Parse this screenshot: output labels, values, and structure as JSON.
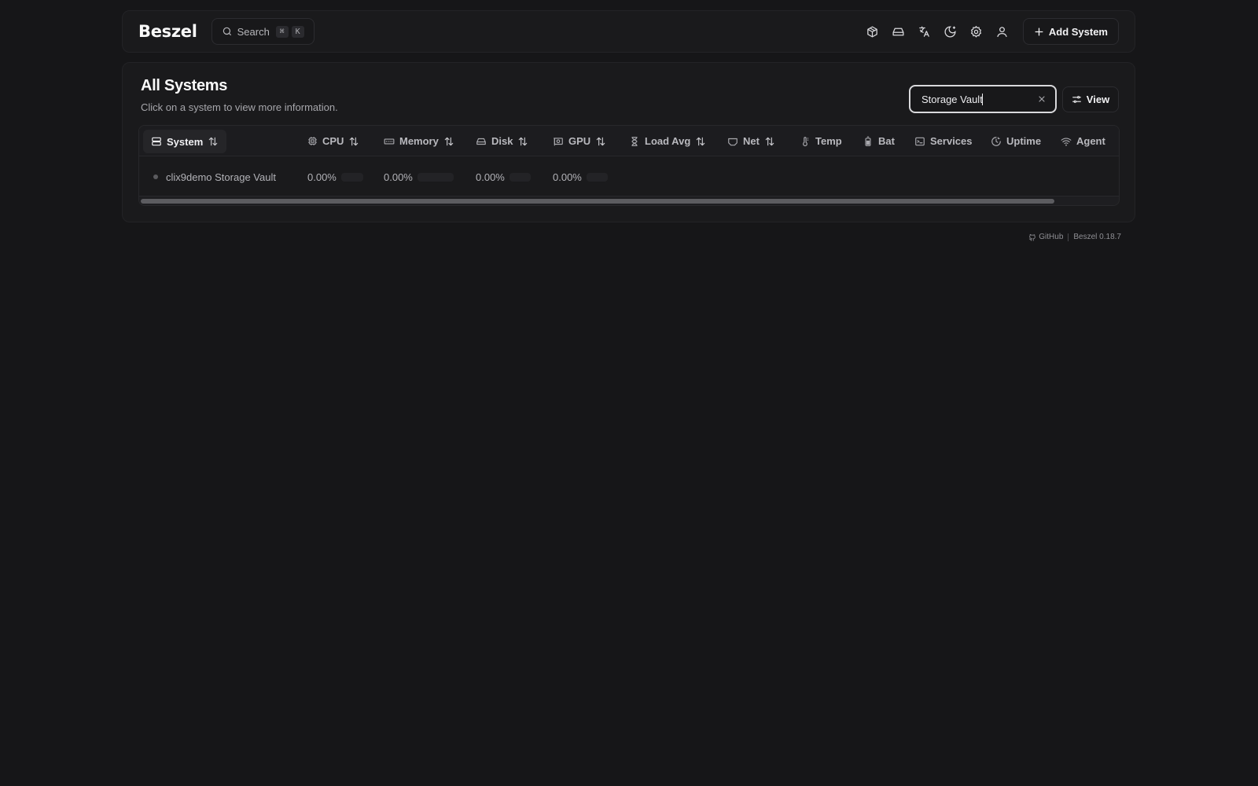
{
  "header": {
    "logo": "Beszel",
    "search": {
      "label": "Search",
      "kbd": [
        "⌘",
        "K"
      ]
    },
    "icons": [
      "box-icon",
      "hard-drive-icon",
      "translate-icon",
      "moon-icon",
      "gear-icon",
      "user-icon"
    ],
    "add_system_label": "Add System"
  },
  "main": {
    "title": "All Systems",
    "subtitle": "Click on a system to view more information.",
    "filter": {
      "value": "Storage Vault"
    },
    "view_label": "View"
  },
  "table": {
    "columns": [
      {
        "label": "System",
        "icon": "server-icon",
        "sortable": true
      },
      {
        "label": "CPU",
        "icon": "cpu-icon",
        "sortable": true
      },
      {
        "label": "Memory",
        "icon": "memory-icon",
        "sortable": true
      },
      {
        "label": "Disk",
        "icon": "hard-drive-icon",
        "sortable": true
      },
      {
        "label": "GPU",
        "icon": "gpu-icon",
        "sortable": true
      },
      {
        "label": "Load Avg",
        "icon": "hourglass-icon",
        "sortable": true
      },
      {
        "label": "Net",
        "icon": "ethernet-icon",
        "sortable": true
      },
      {
        "label": "Temp",
        "icon": "thermometer-icon",
        "sortable": false
      },
      {
        "label": "Bat",
        "icon": "battery-icon",
        "sortable": false
      },
      {
        "label": "Services",
        "icon": "terminal-icon",
        "sortable": false
      },
      {
        "label": "Uptime",
        "icon": "clock-icon",
        "sortable": false
      },
      {
        "label": "Agent",
        "icon": "wifi-icon",
        "sortable": false
      }
    ],
    "rows": [
      {
        "system": "clix9demo Storage Vault",
        "status": "down",
        "cpu": "0.00%",
        "memory": "0.00%",
        "disk": "0.00%",
        "gpu": "0.00%"
      }
    ]
  },
  "footer": {
    "github_label": "GitHub",
    "version": "Beszel 0.18.7"
  },
  "colors": {
    "background": "#161618",
    "surface": "#1a1a1c",
    "border": "#232326",
    "text": "#e8e8ea",
    "muted": "#a6a6ab",
    "status_down": "#5a5a5e"
  }
}
